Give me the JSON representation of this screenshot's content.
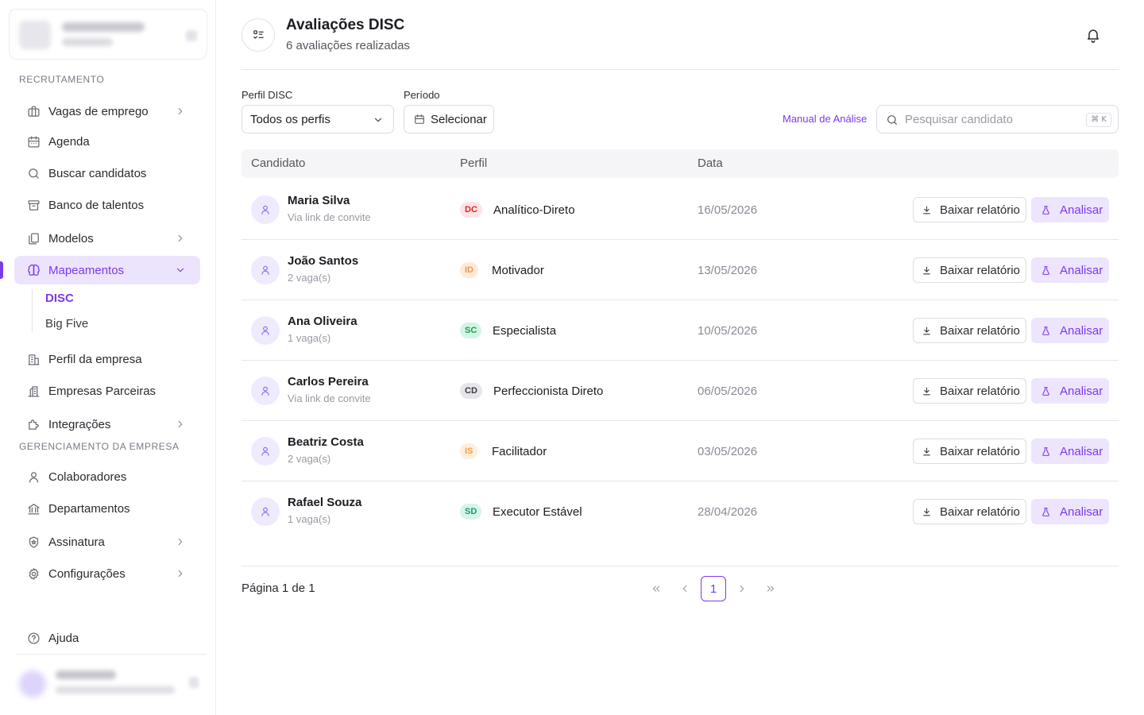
{
  "sidebar": {
    "sections": {
      "recruitment": "RECRUTAMENTO",
      "company": "GERENCIAMENTO DA EMPRESA"
    },
    "items": {
      "vagas": "Vagas de emprego",
      "agenda": "Agenda",
      "buscar": "Buscar candidatos",
      "banco": "Banco de talentos",
      "modelos": "Modelos",
      "mapeamentos": "Mapeamentos",
      "disc": "DISC",
      "bigfive": "Big Five",
      "perfil_empresa": "Perfil da empresa",
      "parceiras": "Empresas Parceiras",
      "integracoes": "Integrações",
      "colaboradores": "Colaboradores",
      "departamentos": "Departamentos",
      "assinatura": "Assinatura",
      "configuracoes": "Configurações",
      "ajuda": "Ajuda"
    },
    "icons": [
      "briefcase-icon",
      "calendar-icon",
      "search-icon",
      "archive-icon",
      "copy-icon",
      "brain-icon",
      "building-icon",
      "buildings-icon",
      "puzzle-icon",
      "user-icon",
      "landmark-icon",
      "badge-icon",
      "settings-icon",
      "help-circle-icon"
    ]
  },
  "header": {
    "title": "Avaliações DISC",
    "subtitle": "6 avaliações realizadas",
    "icons": [
      "list-check-icon",
      "bell-icon"
    ]
  },
  "filters": {
    "profile_label": "Perfil DISC",
    "profile_value": "Todos os perfis",
    "period_label": "Período",
    "period_button": "Selecionar",
    "manual_link": "Manual de Análise",
    "search_placeholder": "Pesquisar candidato",
    "search_shortcut": "⌘ K"
  },
  "table": {
    "columns": {
      "candidate": "Candidato",
      "profile": "Perfil",
      "date": "Data"
    },
    "download_label": "Baixar relatório",
    "analyze_label": "Analisar",
    "rows": [
      {
        "name": "Maria Silva",
        "meta": "Via link de convite",
        "badge": "DC",
        "profile": "Analítico-Direto",
        "date": "16/05/2026"
      },
      {
        "name": "João Santos",
        "meta": "2 vaga(s)",
        "badge": "ID",
        "profile": "Motivador",
        "date": "13/05/2026"
      },
      {
        "name": "Ana Oliveira",
        "meta": "1 vaga(s)",
        "badge": "SC",
        "profile": "Especialista",
        "date": "10/05/2026"
      },
      {
        "name": "Carlos Pereira",
        "meta": "Via link de convite",
        "badge": "CD",
        "profile": "Perfeccionista Direto",
        "date": "06/05/2026"
      },
      {
        "name": "Beatriz Costa",
        "meta": "2 vaga(s)",
        "badge": "IS",
        "profile": "Facilitador",
        "date": "03/05/2026"
      },
      {
        "name": "Rafael Souza",
        "meta": "1 vaga(s)",
        "badge": "SD",
        "profile": "Executor Estável",
        "date": "28/04/2026"
      }
    ],
    "badge_colors": {
      "DC": "#dc2626",
      "ID": "#f2994a",
      "SC": "#16a34a",
      "CD": "#3a3a42",
      "IS": "#f4a04a",
      "SD": "#15a06a"
    }
  },
  "pagination": {
    "info": "Página 1 de 1",
    "current": "1"
  },
  "colors": {
    "accent": "#7c3aed",
    "accent_soft": "#ece4fd"
  }
}
